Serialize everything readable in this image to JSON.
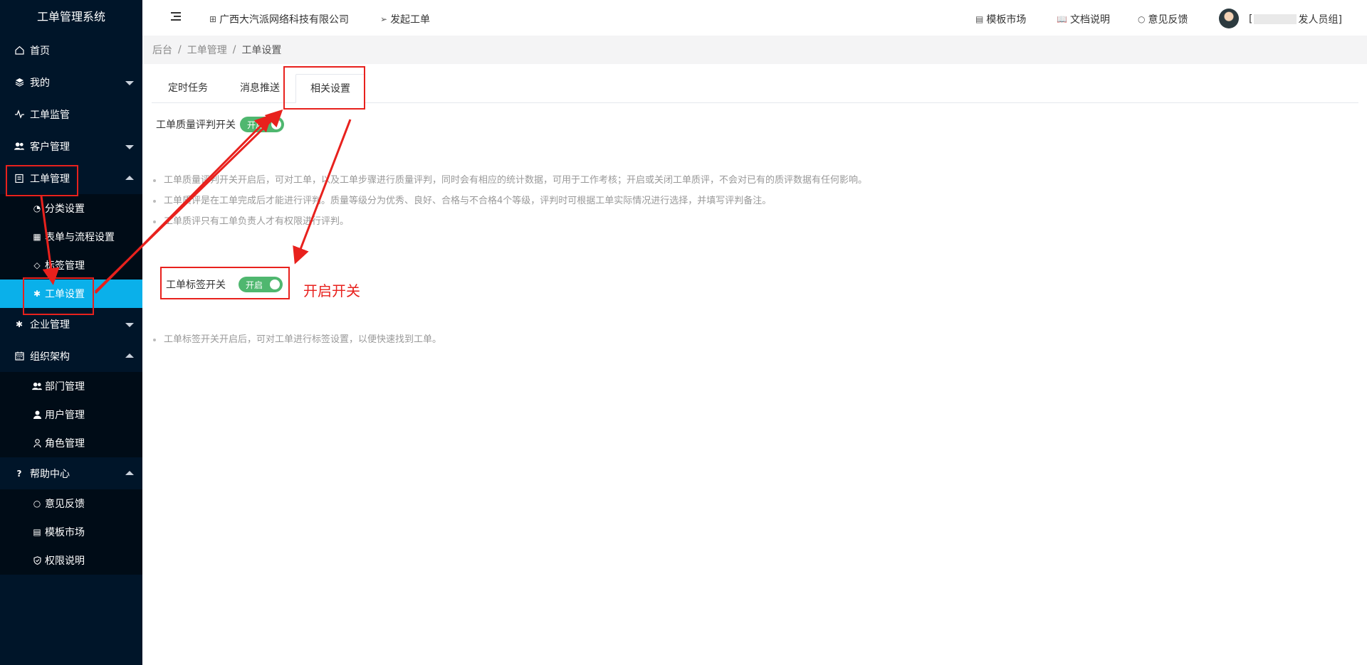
{
  "sidebar": {
    "logo": "工单管理系统",
    "items": [
      {
        "label": "首页",
        "icon": "home-icon"
      },
      {
        "label": "我的",
        "icon": "layers-icon"
      },
      {
        "label": "工单监管",
        "icon": "pulse-icon"
      },
      {
        "label": "客户管理",
        "icon": "users-icon"
      },
      {
        "label": "工单管理",
        "icon": "clipboard-icon"
      },
      {
        "label": "企业管理",
        "icon": "gear-icon"
      },
      {
        "label": "组织架构",
        "icon": "calendar-icon"
      },
      {
        "label": "帮助中心",
        "icon": "question-icon"
      }
    ],
    "ticket_sub": [
      {
        "label": "分类设置"
      },
      {
        "label": "表单与流程设置"
      },
      {
        "label": "标签管理"
      },
      {
        "label": "工单设置"
      }
    ],
    "org_sub": [
      {
        "label": "部门管理"
      },
      {
        "label": "用户管理"
      },
      {
        "label": "角色管理"
      }
    ],
    "help_sub": [
      {
        "label": "意见反馈"
      },
      {
        "label": "模板市场"
      },
      {
        "label": "权限说明"
      }
    ]
  },
  "header": {
    "company": "广西大汽派网络科技有限公司",
    "create_ticket": "发起工单",
    "template_market": "模板市场",
    "docs": "文档说明",
    "feedback": "意见反馈",
    "user_prefix": "[",
    "user_suffix": "发人员组]"
  },
  "breadcrumb": {
    "a": "后台",
    "b": "工单管理",
    "c": "工单设置"
  },
  "tabs": [
    {
      "label": "定时任务"
    },
    {
      "label": "消息推送"
    },
    {
      "label": "相关设置"
    }
  ],
  "quality": {
    "label": "工单质量评判开关",
    "switch": "开启",
    "notes": [
      "工单质量评判开关开启后，可对工单，以及工单步骤进行质量评判，同时会有相应的统计数据，可用于工作考核；开启或关闭工单质评，不会对已有的质评数据有任何影响。",
      "工单质评是在工单完成后才能进行评判。质量等级分为优秀、良好、合格与不合格4个等级，评判时可根据工单实际情况进行选择，并填写评判备注。",
      "工单质评只有工单负责人才有权限进行评判。"
    ]
  },
  "tag": {
    "label": "工单标签开关",
    "switch": "开启",
    "notes": [
      "工单标签开关开启后，可对工单进行标签设置，以便快速找到工单。"
    ]
  },
  "annotation": "开启开关",
  "colors": {
    "sidebar": "#001529",
    "active": "#0ab0ea",
    "switch_on": "#4fb76f",
    "annotation": "#e8211d"
  }
}
